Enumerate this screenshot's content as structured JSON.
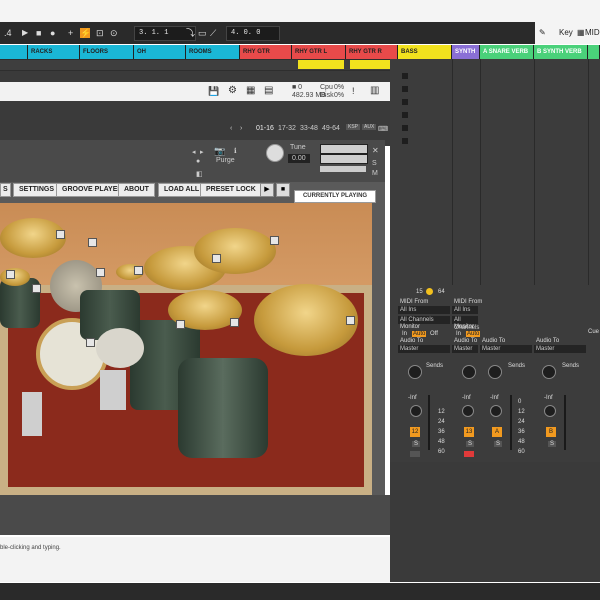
{
  "transport": {
    "left_num": ".4",
    "position": "3.  1.  1",
    "end": "4.  0.  0",
    "key_label": "Key",
    "midi_label": "MIDI"
  },
  "tracks": [
    {
      "name": "",
      "color": "#1ab7d6"
    },
    {
      "name": "RACKS",
      "color": "#1ab7d6"
    },
    {
      "name": "FLOORS",
      "color": "#1ab7d6"
    },
    {
      "name": "OH",
      "color": "#1ab7d6"
    },
    {
      "name": "ROOMS",
      "color": "#1ab7d6"
    },
    {
      "name": "RHY GTR",
      "color": "#e84a4a"
    },
    {
      "name": "RHY GTR L",
      "color": "#e84a4a"
    },
    {
      "name": "RHY GTR R",
      "color": "#e84a4a"
    },
    {
      "name": "BASS",
      "color": "#f2e21e"
    },
    {
      "name": "SYNTH",
      "color": "#8a6fd6"
    },
    {
      "name": "A SNARE VERB",
      "color": "#4ad17a"
    },
    {
      "name": "B SYNTH VERB",
      "color": "#4ad17a"
    },
    {
      "name": "",
      "color": "#4ad17a"
    }
  ],
  "plugin": {
    "cpu_label": "Cpu",
    "cpu_value": "0%",
    "disk_label": "Disk",
    "disk_value": "0%",
    "mem": "482.93 MB",
    "pages": [
      "01-16",
      "17-32",
      "33-48",
      "49-64"
    ],
    "kbd": "KSP",
    "aux": "AUX",
    "purge": "Purge",
    "tune_label": "Tune",
    "tune_value": "0.00"
  },
  "nav": {
    "settings": "SETTINGS",
    "groove": "GROOVE PLAYER",
    "about": "ABOUT",
    "load_all": "LOAD ALL",
    "preset_lock": "PRESET LOCK",
    "currently_playing": "CURRENTLY PLAYING"
  },
  "status_text": "ble-clicking and typing.",
  "mixer": {
    "top_vals": [
      "15",
      "64"
    ],
    "midi_from": "MIDI From",
    "all_ins": "All Ins",
    "all_channels": "All Channels",
    "monitor": "Monitor",
    "in": "In",
    "auto": "Auto",
    "off": "Off",
    "audio_to": "Audio To",
    "master": "Master",
    "sends": "Sends",
    "inf": "-Inf",
    "db": [
      "12",
      "24",
      "36",
      "48",
      "60"
    ],
    "db_b": [
      "0",
      "12",
      "24",
      "36",
      "48",
      "60"
    ],
    "chan_nums": [
      "12",
      "13",
      "A",
      "B"
    ],
    "s": "S",
    "cue": "Cue"
  }
}
